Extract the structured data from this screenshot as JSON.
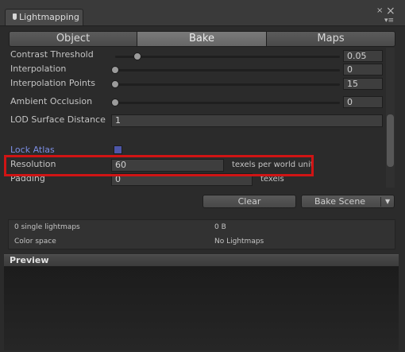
{
  "window": {
    "tab_title": "Lightmapping",
    "close_glyph": "×",
    "menu_glyph": "▾≡"
  },
  "mode_tabs": [
    "Object",
    "Bake",
    "Maps"
  ],
  "active_mode": "Bake",
  "settings": {
    "contrast_threshold": {
      "label": "Contrast Threshold",
      "value": "0.05",
      "fraction": 0.1
    },
    "interpolation": {
      "label": "Interpolation",
      "value": "0",
      "fraction": 0.0
    },
    "interpolation_points": {
      "label": "Interpolation Points",
      "value": "15",
      "fraction": 0.0
    },
    "ambient_occlusion": {
      "label": "Ambient Occlusion",
      "value": "0",
      "fraction": 0.0
    },
    "lod_surface_distance": {
      "label": "LOD Surface Distance",
      "value": "1"
    },
    "lock_atlas": {
      "label": "Lock Atlas",
      "checked": true
    },
    "resolution": {
      "label": "Resolution",
      "value": "60",
      "suffix": "texels per world unit"
    },
    "padding": {
      "label": "Padding",
      "value": "0",
      "suffix": "texels"
    }
  },
  "buttons": {
    "clear": "Clear",
    "bake_scene": "Bake Scene",
    "dropdown_glyph": "▼"
  },
  "stats": {
    "lightmaps": "0 single lightmaps",
    "size": "0 B",
    "color_space_label": "Color space",
    "color_space_value": "No Lightmaps"
  },
  "preview": {
    "title": "Preview"
  },
  "colors": {
    "highlight": "#d01414",
    "lock_atlas_label": "#7d8fe6",
    "checkbox": "#4d56a8"
  }
}
